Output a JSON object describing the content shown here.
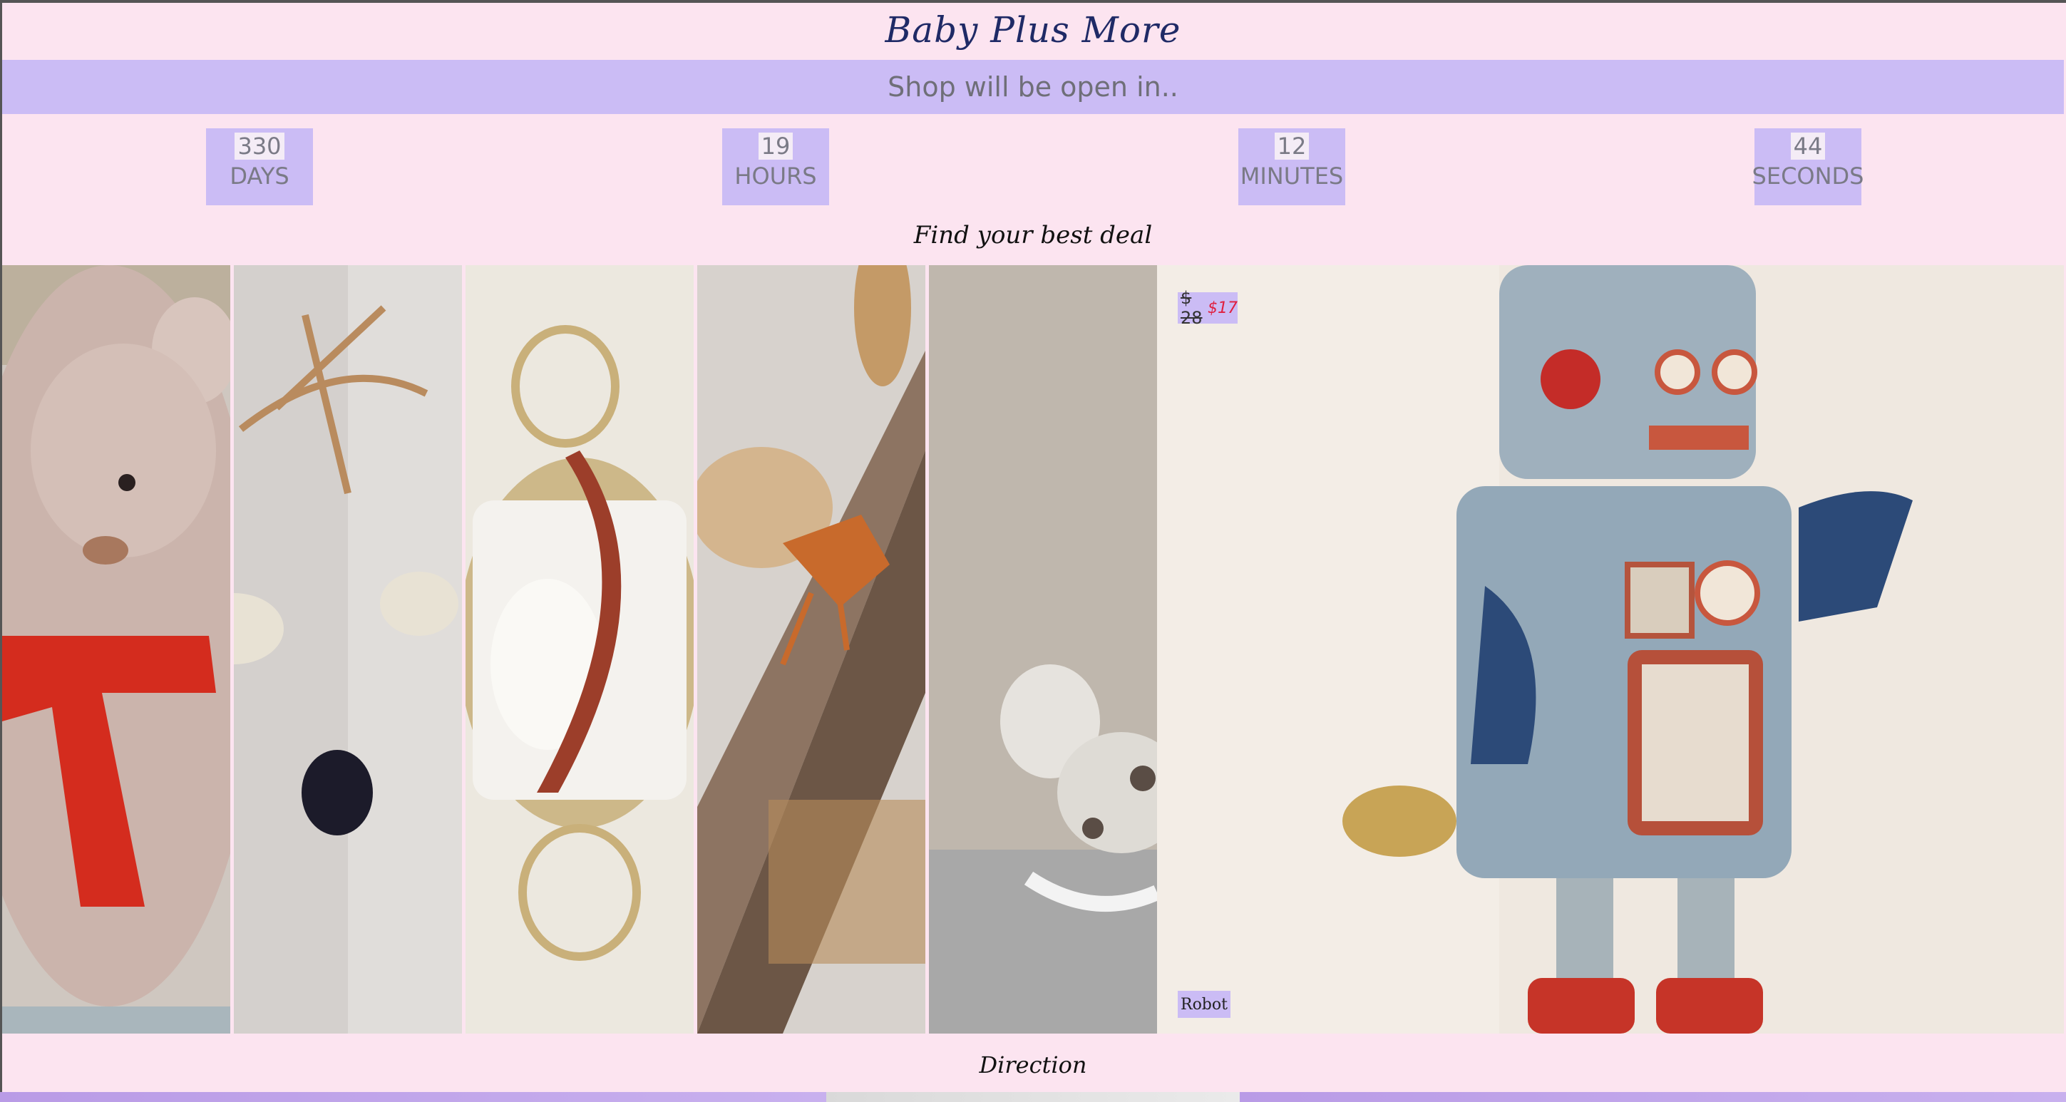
{
  "header": {
    "logo_text": "Baby Plus More"
  },
  "banner": {
    "text": "Shop will be open in.."
  },
  "countdown": [
    {
      "value": "330",
      "unit": "DAYS"
    },
    {
      "value": "19",
      "unit": "HOURS"
    },
    {
      "value": "12",
      "unit": "MINUTES"
    },
    {
      "value": "44",
      "unit": "SECONDS"
    }
  ],
  "deals": {
    "title": "Find your best deal",
    "featured": {
      "old_price": "$ 28",
      "new_price": "$17",
      "name": "Robot"
    },
    "products": [
      {
        "image": "teddy-bear"
      },
      {
        "image": "sheep-mobile"
      },
      {
        "image": "bunny-basket"
      },
      {
        "image": "hermit-crab-shelf"
      },
      {
        "image": "rocking-giraffe"
      },
      {
        "image": "toy-robot"
      }
    ]
  },
  "footer": {
    "direction_label": "Direction"
  },
  "colors": {
    "background": "#fce4f0",
    "accent": "#cbbcf5",
    "logo": "#1f2a66",
    "sale": "#e02040"
  }
}
